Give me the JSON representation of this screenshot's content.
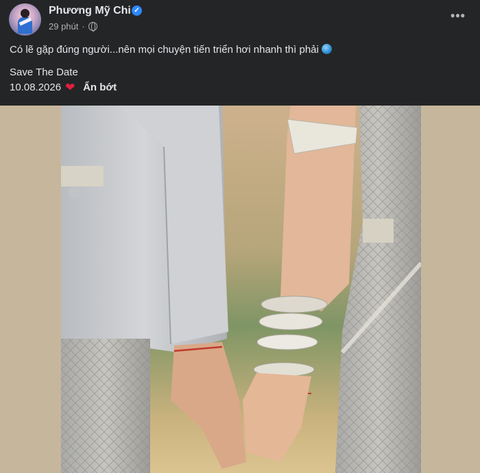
{
  "post": {
    "author": "Phương Mỹ Chi",
    "time": "29 phút",
    "separator": "·",
    "more_label": "•••",
    "caption": "Có lẽ gặp đúng người...nên mọi chuyện tiến triển hơi nhanh thì phải",
    "save_the_date": "Save The Date",
    "date": "10.08.2026",
    "heart": "❤",
    "see_less": "Ẩn bớt"
  },
  "icons": {
    "verified": "verified-badge-icon",
    "privacy": "globe-icon",
    "more": "more-options-icon",
    "caption_emoji": "globe-emoji-icon",
    "heart": "red-heart-icon"
  },
  "colors": {
    "background": "#242526",
    "text": "#e4e6eb",
    "secondary_text": "#b0b3b8",
    "verified_blue": "#2d88ff",
    "heart_red": "#e41e3f",
    "photo_matte": "#c6b79c"
  }
}
